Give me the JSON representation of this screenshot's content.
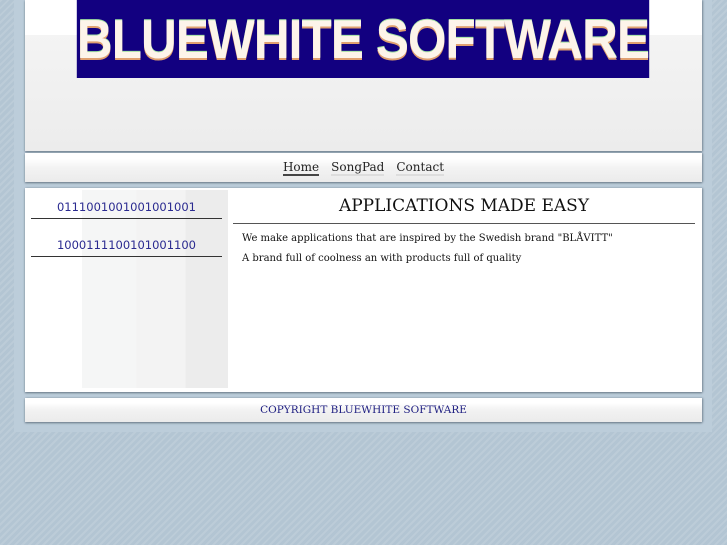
{
  "header": {
    "logo_text": "BLUEWHITE SOFTWARE"
  },
  "nav": {
    "items": [
      {
        "label": "Home"
      },
      {
        "label": "SongPad"
      },
      {
        "label": "Contact"
      }
    ]
  },
  "sidebar": {
    "links": [
      {
        "label": "0111001001001001001"
      },
      {
        "label": "1000111100101001100"
      }
    ]
  },
  "main": {
    "title": "APPLICATIONS MADE EASY",
    "paragraphs": [
      "We make applications that are inspired by  the Swedish brand \"BLÅVITT\"",
      "A brand full of coolness an with products full of quality"
    ]
  },
  "footer": {
    "text": "COPYRIGHT BLUEWHITE SOFTWARE"
  }
}
